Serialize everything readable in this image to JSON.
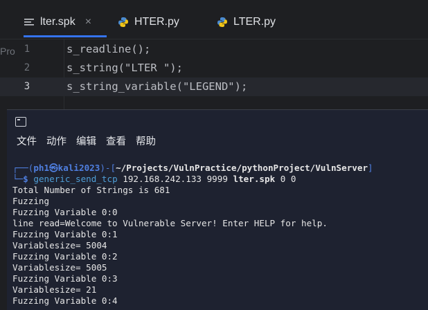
{
  "editor": {
    "tabs": [
      {
        "label": "lter.spk",
        "close": "×",
        "icon": "text-file-icon",
        "active": true
      },
      {
        "label": "HTER.py",
        "icon": "python-icon",
        "active": false
      },
      {
        "label": "LTER.py",
        "icon": "python-icon",
        "active": false
      }
    ],
    "edge_text": "Pro",
    "lines": [
      {
        "num": "1",
        "text": "s_readline();"
      },
      {
        "num": "2",
        "text": "s_string(\"LTER \");"
      },
      {
        "num": "3",
        "text": "s_string_variable(\"LEGEND\");",
        "current": true
      }
    ]
  },
  "terminal": {
    "menu": [
      "文件",
      "动作",
      "编辑",
      "查看",
      "帮助"
    ],
    "prompt": {
      "corner_top": "┌──(",
      "user": "ph1㉿kali2023",
      "mid": ")-[",
      "path": "~/Projects/VulnPractice/pythonProject/VulnServer",
      "end": "]",
      "corner_bottom": "└─",
      "dollar": "$",
      "command": "generic_send_tcp",
      "args_plain": " 192.168.242.133 9999 ",
      "args_bold": "lter.spk",
      "args_tail": " 0 0"
    },
    "output": [
      "Total Number of Strings is 681",
      "Fuzzing",
      "Fuzzing Variable 0:0",
      "line read=Welcome to Vulnerable Server! Enter HELP for help.",
      "Fuzzing Variable 0:1",
      "Variablesize= 5004",
      "Fuzzing Variable 0:2",
      "Variablesize= 5005",
      "Fuzzing Variable 0:3",
      "Variablesize= 21",
      "Fuzzing Variable 0:4"
    ]
  },
  "colors": {
    "accent": "#3574f0",
    "prompt_blue": "#4f7fe0"
  }
}
